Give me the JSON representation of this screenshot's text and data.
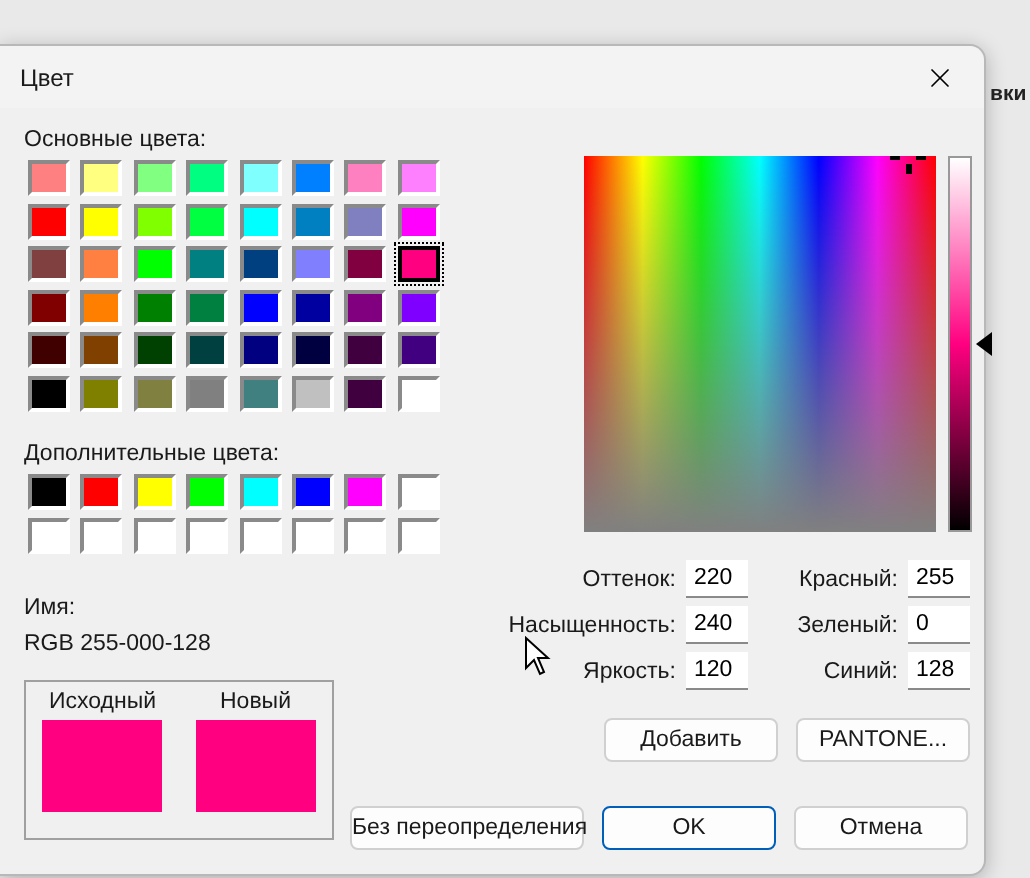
{
  "background": {
    "tab_text": "вки"
  },
  "dialog": {
    "title": "Цвет"
  },
  "basic_colors": {
    "label": "Основные цвета:",
    "swatches": [
      {
        "color": "#ff8080",
        "selected": false
      },
      {
        "color": "#ffff80",
        "selected": false
      },
      {
        "color": "#80ff80",
        "selected": false
      },
      {
        "color": "#00ff80",
        "selected": false
      },
      {
        "color": "#80ffff",
        "selected": false
      },
      {
        "color": "#0080ff",
        "selected": false
      },
      {
        "color": "#ff80c0",
        "selected": false
      },
      {
        "color": "#ff80ff",
        "selected": false
      },
      {
        "color": "#ff0000",
        "selected": false
      },
      {
        "color": "#ffff00",
        "selected": false
      },
      {
        "color": "#80ff00",
        "selected": false
      },
      {
        "color": "#00ff40",
        "selected": false
      },
      {
        "color": "#00ffff",
        "selected": false
      },
      {
        "color": "#0080c0",
        "selected": false
      },
      {
        "color": "#8080c0",
        "selected": false
      },
      {
        "color": "#ff00ff",
        "selected": false
      },
      {
        "color": "#804040",
        "selected": false
      },
      {
        "color": "#ff8040",
        "selected": false
      },
      {
        "color": "#00ff00",
        "selected": false
      },
      {
        "color": "#008080",
        "selected": false
      },
      {
        "color": "#004080",
        "selected": false
      },
      {
        "color": "#8080ff",
        "selected": false
      },
      {
        "color": "#800040",
        "selected": false
      },
      {
        "color": "#ff0080",
        "selected": true
      },
      {
        "color": "#800000",
        "selected": false
      },
      {
        "color": "#ff8000",
        "selected": false
      },
      {
        "color": "#008000",
        "selected": false
      },
      {
        "color": "#008040",
        "selected": false
      },
      {
        "color": "#0000ff",
        "selected": false
      },
      {
        "color": "#0000a0",
        "selected": false
      },
      {
        "color": "#800080",
        "selected": false
      },
      {
        "color": "#8000ff",
        "selected": false
      },
      {
        "color": "#400000",
        "selected": false
      },
      {
        "color": "#804000",
        "selected": false
      },
      {
        "color": "#004000",
        "selected": false
      },
      {
        "color": "#004040",
        "selected": false
      },
      {
        "color": "#000080",
        "selected": false
      },
      {
        "color": "#000040",
        "selected": false
      },
      {
        "color": "#400040",
        "selected": false
      },
      {
        "color": "#400080",
        "selected": false
      },
      {
        "color": "#000000",
        "selected": false
      },
      {
        "color": "#808000",
        "selected": false
      },
      {
        "color": "#808040",
        "selected": false
      },
      {
        "color": "#808080",
        "selected": false
      },
      {
        "color": "#408080",
        "selected": false
      },
      {
        "color": "#c0c0c0",
        "selected": false
      },
      {
        "color": "#400040",
        "selected": false
      },
      {
        "color": "#ffffff",
        "selected": false
      }
    ]
  },
  "custom_colors": {
    "label": "Дополнительные цвета:",
    "swatches": [
      {
        "color": "#000000"
      },
      {
        "color": "#ff0000"
      },
      {
        "color": "#ffff00"
      },
      {
        "color": "#00ff00"
      },
      {
        "color": "#00ffff"
      },
      {
        "color": "#0000ff"
      },
      {
        "color": "#ff00ff"
      },
      {
        "color": "#ffffff"
      },
      {
        "color": "#ffffff"
      },
      {
        "color": "#ffffff"
      },
      {
        "color": "#ffffff"
      },
      {
        "color": "#ffffff"
      },
      {
        "color": "#ffffff"
      },
      {
        "color": "#ffffff"
      },
      {
        "color": "#ffffff"
      },
      {
        "color": "#ffffff"
      }
    ]
  },
  "name": {
    "label": "Имя:",
    "value": "RGB 255-000-128"
  },
  "preview": [
    {
      "label": "Исходный",
      "color": "#ff0080"
    },
    {
      "label": "Новый",
      "color": "#ff0080"
    }
  ],
  "luminance_bar": {
    "level": 0.5
  },
  "fields": [
    {
      "label": "Оттенок:",
      "value": "220"
    },
    {
      "label": "Красный:",
      "value": "255"
    },
    {
      "label": "Насыщенность:",
      "value": "240"
    },
    {
      "label": "Зеленый:",
      "value": "0"
    },
    {
      "label": "Яркость:",
      "value": "120"
    },
    {
      "label": "Синий:",
      "value": "128"
    }
  ],
  "buttons": [
    {
      "label": "Добавить"
    },
    {
      "label": "PANTONE..."
    }
  ],
  "footer_buttons": [
    {
      "label": "Без переопределения",
      "default": false
    },
    {
      "label": "OK",
      "default": true
    },
    {
      "label": "Отмена",
      "default": false
    }
  ]
}
